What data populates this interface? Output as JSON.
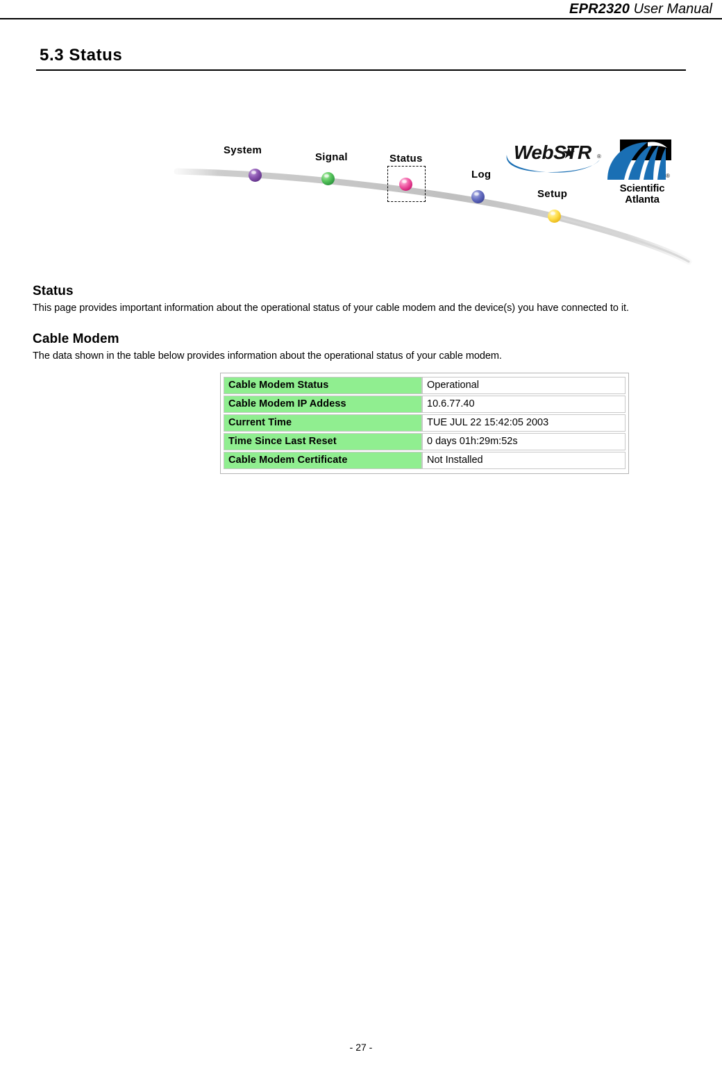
{
  "header": {
    "model": "EPR2320",
    "subtitle": "User Manual"
  },
  "section": {
    "heading": "5.3 Status"
  },
  "nav_banner": {
    "nodes": [
      {
        "label": "System",
        "color": "#7a4a9e"
      },
      {
        "label": "Signal",
        "color": "#33aa44"
      },
      {
        "label": "Status",
        "color": "#e8458f",
        "selected": true
      },
      {
        "label": "Log",
        "color": "#4a50a8"
      },
      {
        "label": "Setup",
        "color": "#f5d033"
      }
    ],
    "webstar_logo": {
      "text_before": "WebST",
      "star": "★",
      "text_after": "R",
      "registered": "®"
    },
    "scientific_atlanta_logo": {
      "line1": "Scientific",
      "line2": "Atlanta",
      "registered": "®"
    }
  },
  "content": {
    "status_heading": "Status",
    "status_paragraph": "This page provides important information about the operational status of your cable modem and the device(s) you have connected to it.",
    "cable_modem_heading": "Cable Modem",
    "cable_modem_paragraph": "The data shown in the table below provides information about the operational status of your cable modem."
  },
  "status_table": {
    "rows": [
      {
        "label": "Cable Modem Status",
        "value": "Operational"
      },
      {
        "label": "Cable Modem IP Addess",
        "value": "10.6.77.40"
      },
      {
        "label": "Current Time",
        "value": "TUE JUL 22 15:42:05 2003"
      },
      {
        "label": "Time Since Last Reset",
        "value": "0 days 01h:29m:52s"
      },
      {
        "label": "Cable Modem Certificate",
        "value": "Not Installed"
      }
    ]
  },
  "footer": {
    "page_number": "- 27 -"
  },
  "colors": {
    "table_label_bg": "#90ee90",
    "curve": "#c4c4c4",
    "sa_blue": "#1a6fb4"
  }
}
